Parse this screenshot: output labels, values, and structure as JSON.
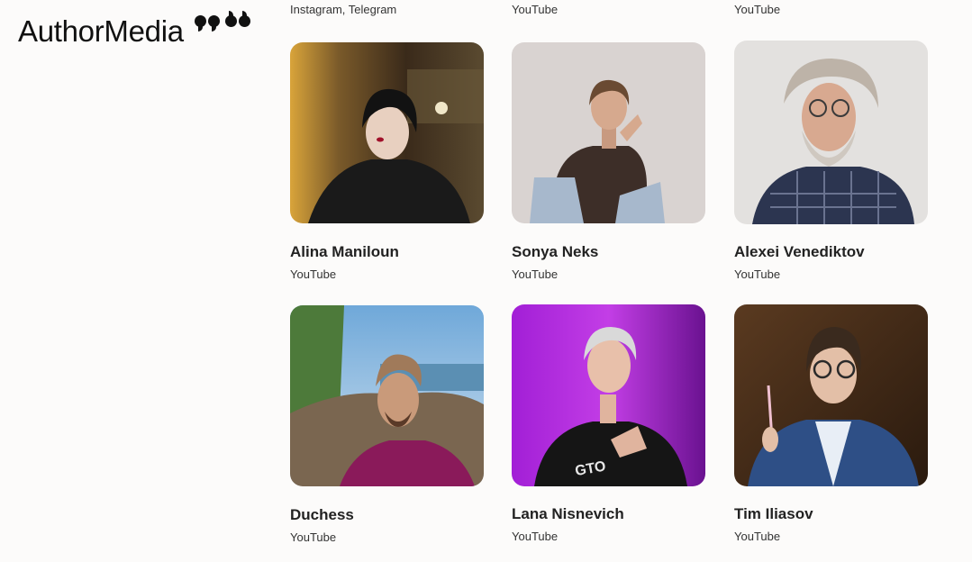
{
  "brand": {
    "name": "AuthorMedia"
  },
  "previous_row": [
    {
      "platform": "Instagram, Telegram"
    },
    {
      "platform": "YouTube"
    },
    {
      "platform": "YouTube"
    }
  ],
  "authors": [
    {
      "name": "Alina Maniloun",
      "platform": "YouTube"
    },
    {
      "name": "Sonya Neks",
      "platform": "YouTube"
    },
    {
      "name": "Alexei Venediktov",
      "platform": "YouTube"
    },
    {
      "name": "Duchess",
      "platform": "YouTube"
    },
    {
      "name": "Lana Nisnevich",
      "platform": "YouTube"
    },
    {
      "name": "Tim Iliasov",
      "platform": "YouTube"
    }
  ]
}
